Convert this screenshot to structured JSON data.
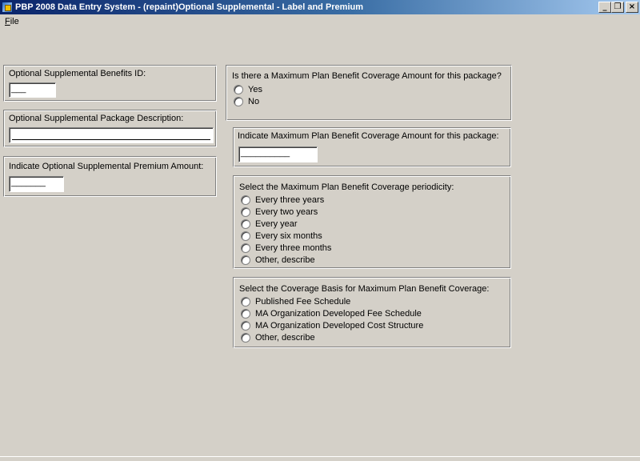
{
  "window": {
    "title": "PBP 2008 Data Entry System - (repaint)Optional Supplemental - Label and Premium",
    "minimize_glyph": "_",
    "restore_glyph": "❐",
    "close_glyph": "×"
  },
  "menu": {
    "file_accel": "F",
    "file_rest": "ile"
  },
  "benefits_id": {
    "label": "Optional Supplemental Benefits ID:",
    "value": "___"
  },
  "package_description": {
    "label": "Optional Supplemental Package Description:",
    "value": ""
  },
  "premium": {
    "label": "Indicate Optional Supplemental Premium Amount:",
    "value": "_______"
  },
  "max_coverage_question": {
    "label": "Is there a Maximum Plan Benefit Coverage Amount for this package?",
    "options": [
      "Yes",
      "No"
    ]
  },
  "max_coverage_amount": {
    "label": "Indicate Maximum Plan Benefit Coverage Amount for this package:",
    "value": "__________"
  },
  "periodicity": {
    "label": "Select the Maximum Plan Benefit Coverage periodicity:",
    "options": [
      "Every three years",
      "Every two years",
      "Every year",
      "Every six months",
      "Every three months",
      "Other, describe"
    ]
  },
  "coverage_basis": {
    "label": "Select the Coverage Basis for Maximum Plan Benefit Coverage:",
    "options": [
      "Published Fee Schedule",
      "MA Organization Developed Fee Schedule",
      "MA Organization Developed Cost Structure",
      "Other, describe"
    ]
  }
}
